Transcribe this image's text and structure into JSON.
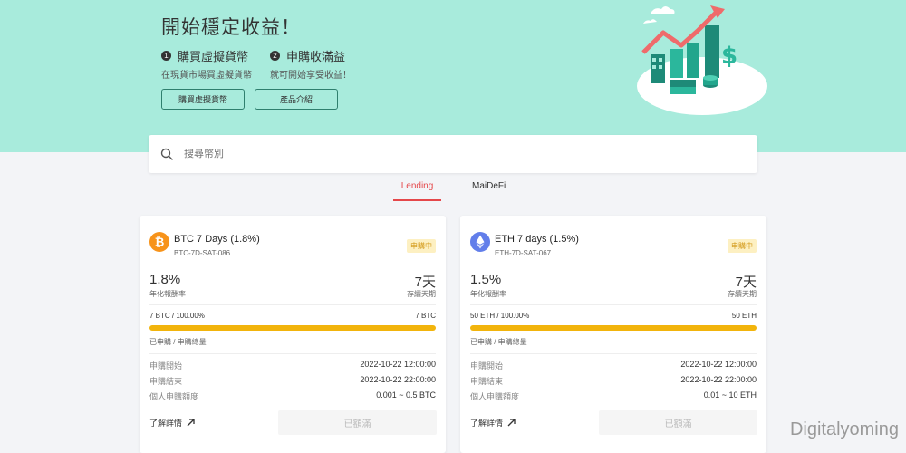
{
  "hero": {
    "title": "開始穩定收益！",
    "steps": [
      {
        "num": "1",
        "title": "購買虛擬貨幣",
        "desc": "在現貨市場買虛擬貨幣"
      },
      {
        "num": "2",
        "title": "申購收滿益",
        "desc": "就可開始享受收益！"
      }
    ],
    "buttons": {
      "buy": "購買虛擬貨幣",
      "intro": "產品介紹"
    }
  },
  "search": {
    "placeholder": "搜尋幣別",
    "icon": "search-icon"
  },
  "tabs": [
    {
      "label": "Lending",
      "active": true
    },
    {
      "label": "MaiDeFi",
      "active": false
    }
  ],
  "colors": {
    "hero_bg": "#a8ebdc",
    "accent": "#e5474a",
    "progress": "#f2b40c",
    "btc": "#f7931a",
    "eth": "#627eea",
    "badge_bg": "#fdf0c2",
    "badge_text": "#d49b1d"
  },
  "cards": [
    {
      "icon": "bitcoin-icon",
      "name": "BTC 7 Days (1.8%)",
      "code": "BTC-7D-SAT-086",
      "badge": "申購中",
      "rate": "1.8%",
      "rate_label": "年化報酬率",
      "days": "7天",
      "days_label": "存續天期",
      "amount": "7 BTC / 100.00%",
      "total": "7 BTC",
      "progress_pct": 100,
      "progress_label": "已申購 / 申購總量",
      "rows": [
        {
          "k": "申購開始",
          "v": "2022-10-22 12:00:00"
        },
        {
          "k": "申購結束",
          "v": "2022-10-22 22:00:00"
        },
        {
          "k": "個人申購額度",
          "v": "0.001 ~ 0.5 BTC"
        }
      ],
      "detail": "了解詳情",
      "button": "已額滿"
    },
    {
      "icon": "ethereum-icon",
      "name": "ETH 7 days (1.5%)",
      "code": "ETH-7D-SAT-067",
      "badge": "申購中",
      "rate": "1.5%",
      "rate_label": "年化報酬率",
      "days": "7天",
      "days_label": "存續天期",
      "amount": "50 ETH / 100.00%",
      "total": "50 ETH",
      "progress_pct": 100,
      "progress_label": "已申購 / 申購總量",
      "rows": [
        {
          "k": "申購開始",
          "v": "2022-10-22 12:00:00"
        },
        {
          "k": "申購結束",
          "v": "2022-10-22 22:00:00"
        },
        {
          "k": "個人申購額度",
          "v": "0.01 ~ 10 ETH"
        }
      ],
      "detail": "了解詳情",
      "button": "已額滿"
    }
  ],
  "watermark": "Digitalyoming"
}
